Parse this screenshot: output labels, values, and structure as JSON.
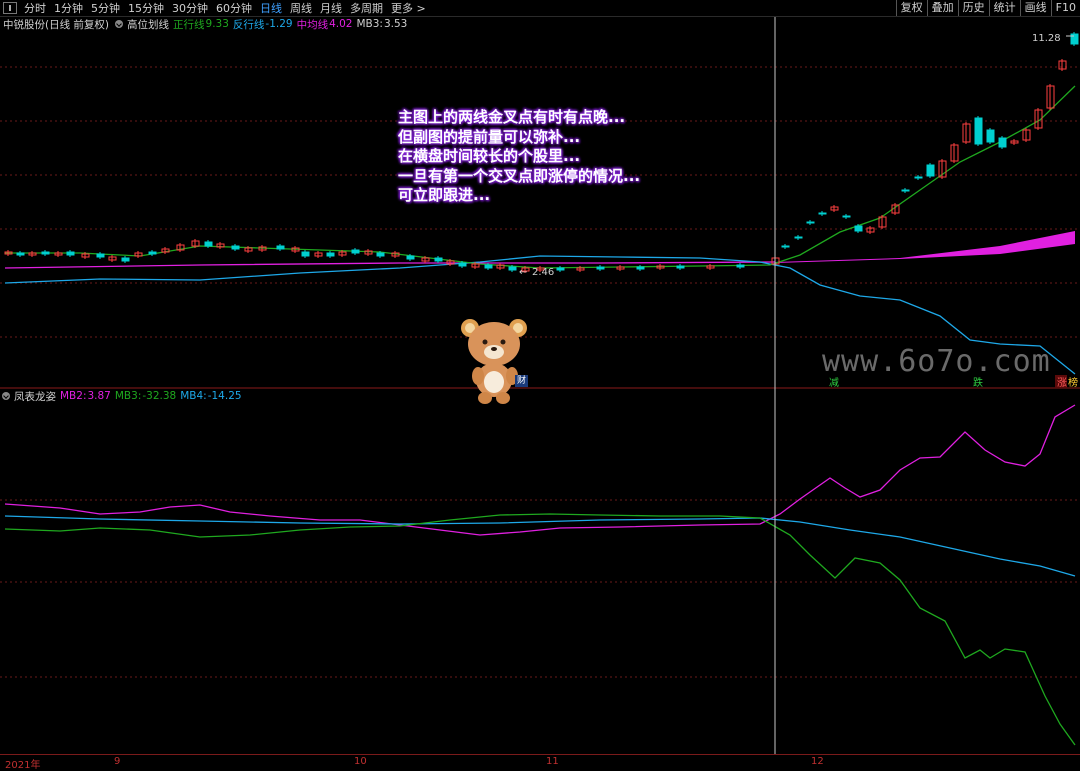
{
  "toolbar": {
    "periods": [
      "分时",
      "1分钟",
      "5分钟",
      "15分钟",
      "30分钟",
      "60分钟",
      "日线",
      "周线",
      "月线",
      "多周期",
      "更多 >"
    ],
    "active_index": 6,
    "right_buttons": [
      "复权",
      "叠加",
      "历史",
      "统计",
      "画线",
      "F10"
    ]
  },
  "main_header": {
    "stock": "中锐股份(日线 前复权)",
    "indicator": "高位划线",
    "line1_label": "正行线",
    "line1_value": "9.33",
    "line2_label": "反行线",
    "line2_value": "-1.29",
    "line3_label": "中均线",
    "line3_value": "4.02",
    "mb3_label": "MB3:",
    "mb3_value": "3.53"
  },
  "annotation_lines": [
    "主图上的两线金叉点有时有点晚...",
    "但副图的提前量可以弥补...",
    "在横盘时间较长的个股里...",
    "一旦有第一个交叉点即涨停的情况...",
    "可立即跟进..."
  ],
  "price_labels": {
    "high": "11.28",
    "low": "2.46"
  },
  "watermark": "www.6o7o.com",
  "bear_tag": "财",
  "event_tags": [
    {
      "text": "减",
      "color": "#2ecc40"
    },
    {
      "text": "跌",
      "color": "#2ecc40"
    },
    {
      "text": "涨",
      "color": "#ff5a5a"
    },
    {
      "text": "榜",
      "color": "#ffcc33"
    }
  ],
  "sub_header": {
    "name": "凤表龙姿",
    "mb2_label": "MB2:",
    "mb2_value": "3.87",
    "mb3_label": "MB3:",
    "mb3_value": "-32.38",
    "mb4_label": "MB4:",
    "mb4_value": "-14.25"
  },
  "date_axis": [
    {
      "label": "2021年"
    },
    {
      "label": "9"
    },
    {
      "label": "10"
    },
    {
      "label": "11"
    },
    {
      "label": "12"
    }
  ],
  "colors": {
    "up": "#ff4040",
    "down": "#00d0d0",
    "green_line": "#1fa81f",
    "blue_line": "#1ea8e8",
    "magenta": "#e020e0",
    "grid": "#6a1a1a"
  }
}
